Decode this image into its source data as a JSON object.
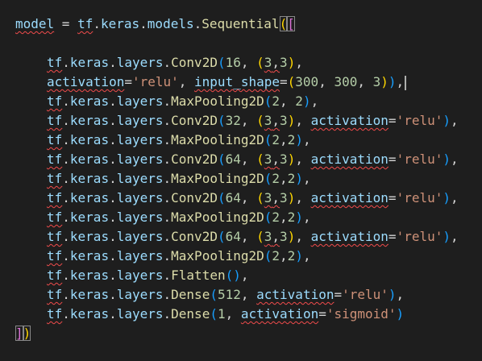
{
  "editor": {
    "language": "python",
    "colors": {
      "background": "#1e1e1e",
      "variable": "#9cdcfe",
      "function": "#dcdcaa",
      "number": "#b5cea8",
      "string": "#ce9178",
      "punctuation": "#d4d4d4",
      "bracket_level_1": "#ffd700",
      "bracket_level_2": "#da70d6",
      "bracket_level_3": "#179fff",
      "error_squiggle": "#f14c4c"
    },
    "lines": [
      "model = tf.keras.models.Sequential([",
      "",
      "    tf.keras.layers.Conv2D(16, (3,3),",
      "    activation='relu', input_shape=(300, 300, 3)),",
      "    tf.keras.layers.MaxPooling2D(2, 2),",
      "    tf.keras.layers.Conv2D(32, (3,3), activation='relu'),",
      "    tf.keras.layers.MaxPooling2D(2,2),",
      "    tf.keras.layers.Conv2D(64, (3,3), activation='relu'),",
      "    tf.keras.layers.MaxPooling2D(2,2),",
      "    tf.keras.layers.Conv2D(64, (3,3), activation='relu'),",
      "    tf.keras.layers.MaxPooling2D(2,2),",
      "    tf.keras.layers.Conv2D(64, (3,3), activation='relu'),",
      "    tf.keras.layers.MaxPooling2D(2,2),",
      "    tf.keras.layers.Flatten(),",
      "    tf.keras.layers.Dense(512, activation='relu'),",
      "    tf.keras.layers.Dense(1, activation='sigmoid')",
      "])"
    ],
    "tokens": {
      "model": "model",
      "eq": " = ",
      "tf": "tf",
      "dot": ".",
      "keras": "keras",
      "models": "models",
      "layers": "layers",
      "sequential": "Sequential",
      "conv2d": "Conv2D",
      "maxpool": "MaxPooling2D",
      "flatten": "Flatten",
      "dense": "Dense",
      "activation": "activation",
      "input_shape": "input_shape",
      "relu": "'relu'",
      "sigmoid": "'sigmoid'",
      "n16": "16",
      "n32": "32",
      "n64": "64",
      "n2": "2",
      "n3": "3",
      "n300": "300",
      "n512": "512",
      "n1": "1"
    }
  }
}
